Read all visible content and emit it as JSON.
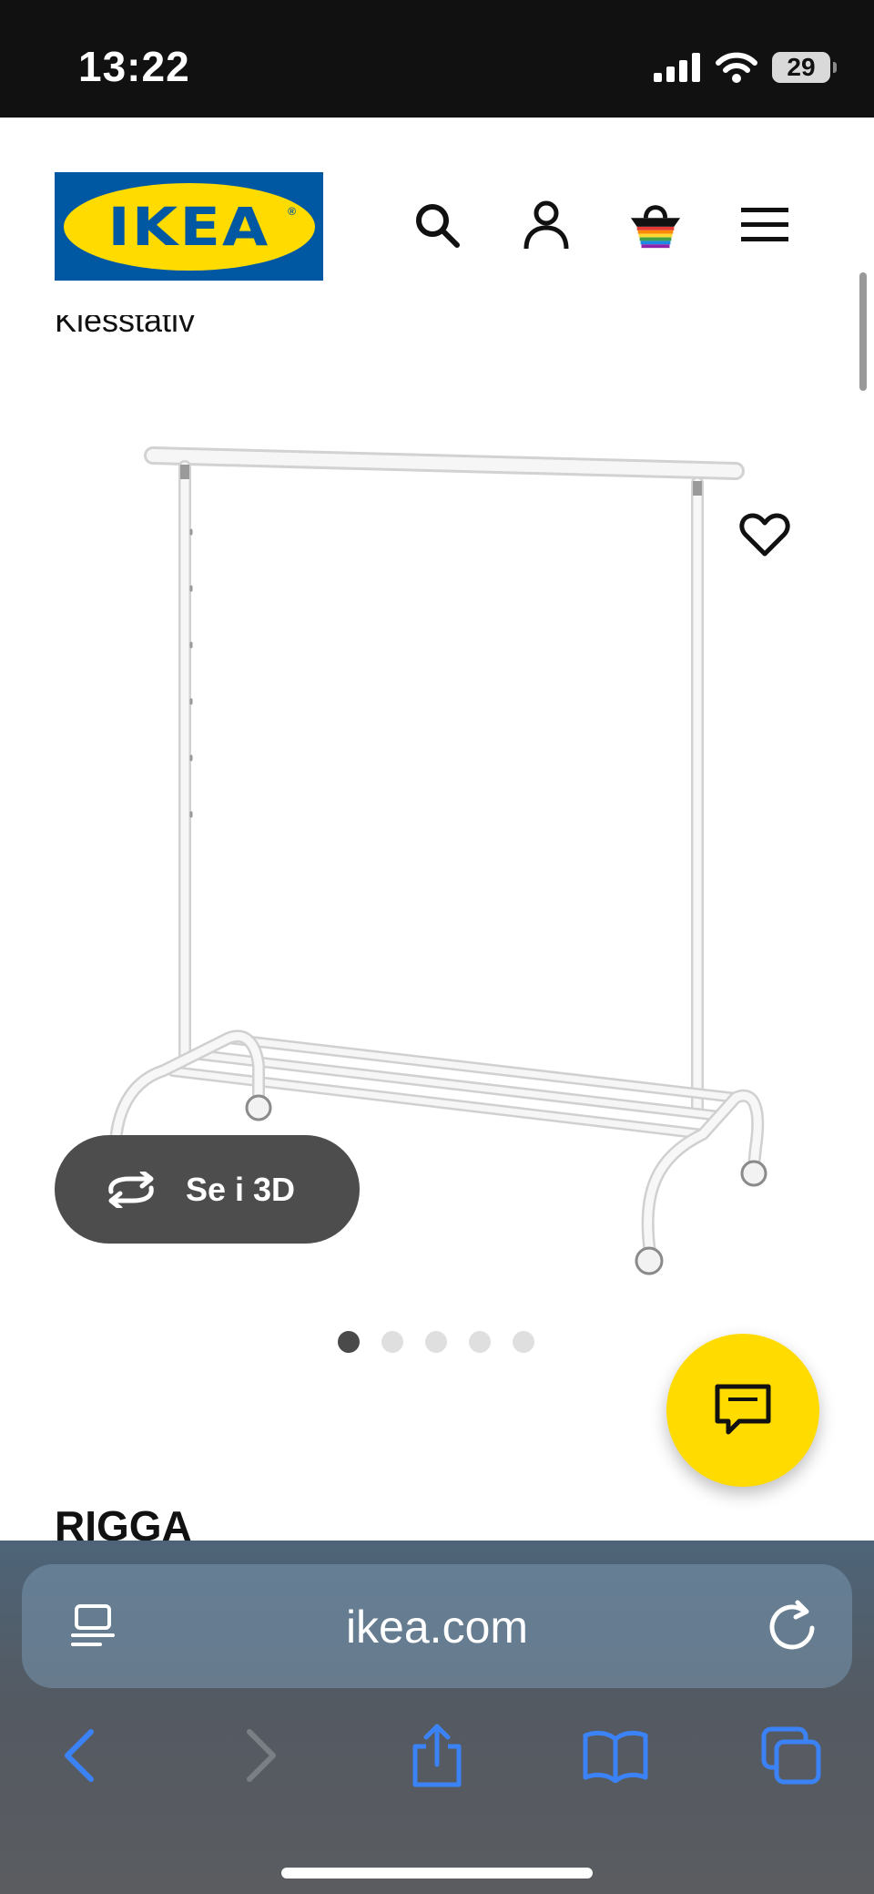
{
  "status_bar": {
    "time": "13:22",
    "battery": "29"
  },
  "header": {
    "logo_text": "IKEA",
    "logo_registered": "®",
    "icons": [
      "search-icon",
      "account-icon",
      "shopping-basket-icon",
      "hamburger-menu-icon"
    ]
  },
  "product": {
    "category_cut": "Klesstativ",
    "name": "RIGGA",
    "view_3d_label": "Se i 3D",
    "image_count": 5,
    "active_image_index": 1
  },
  "browser": {
    "url": "ikea.com",
    "icons": [
      "page-menu-icon",
      "reload-icon",
      "back-icon",
      "forward-icon",
      "share-icon",
      "bookmarks-icon",
      "tabs-icon"
    ]
  },
  "colors": {
    "ikea_blue": "#0058a3",
    "ikea_yellow": "#ffdb00",
    "safari_blue": "#3b82f6",
    "status_bar_bg": "#111111"
  }
}
